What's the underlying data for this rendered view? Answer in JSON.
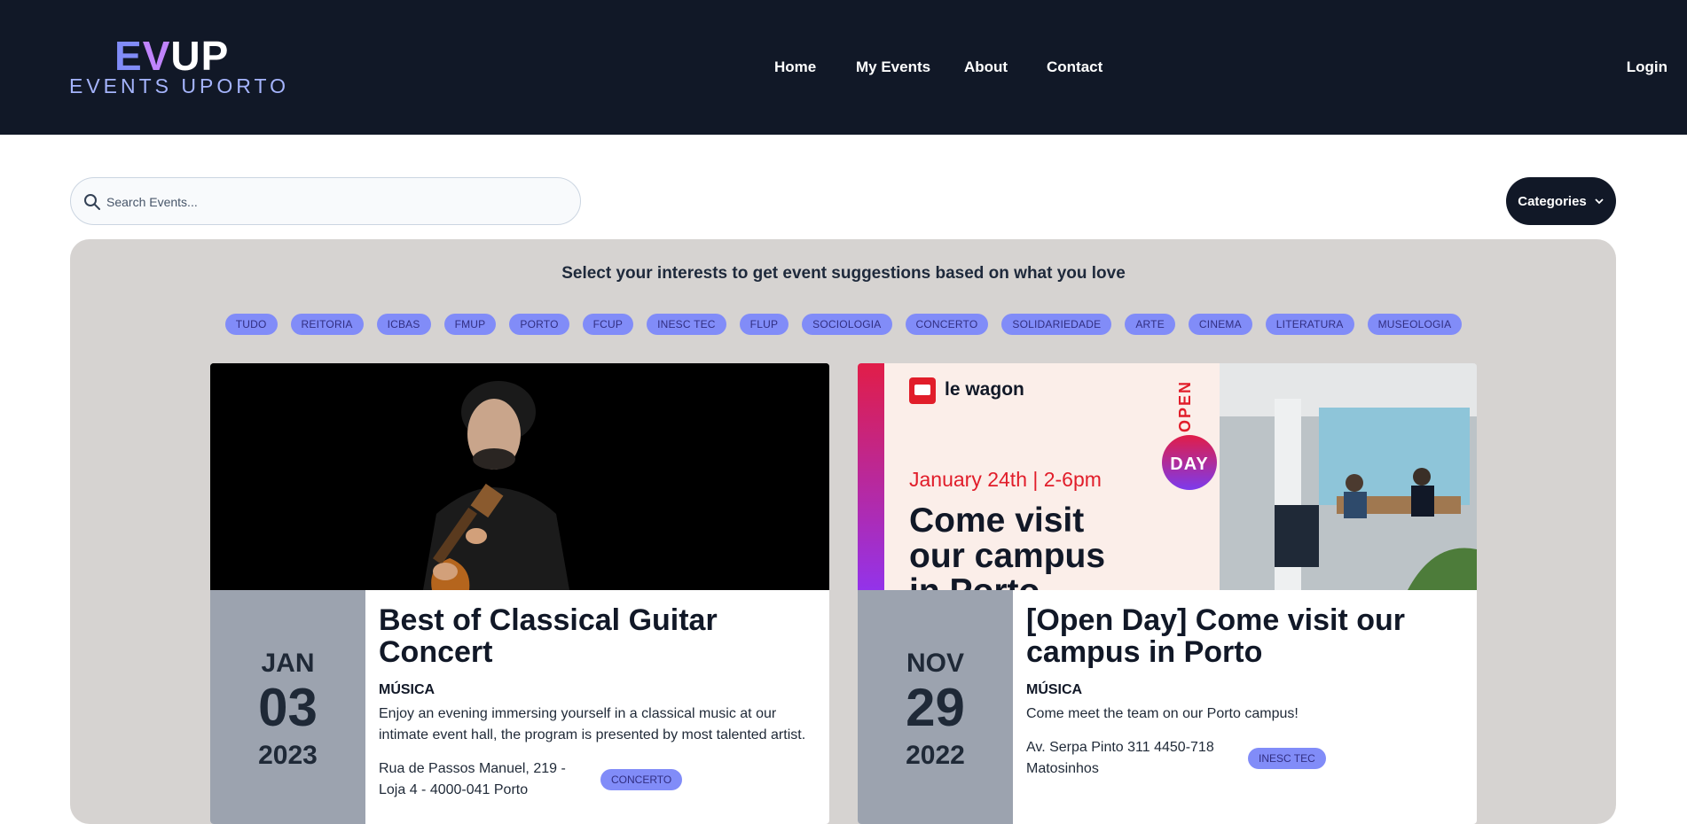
{
  "brand": {
    "logo_e": "E",
    "logo_v": "V",
    "logo_up": "UP",
    "subtitle": "EVENTS UPORTO"
  },
  "nav": {
    "items": [
      "Home",
      "My Events",
      "About",
      "Contact"
    ],
    "login": "Login"
  },
  "search": {
    "placeholder": "Search Events..."
  },
  "categories_button": {
    "label": "Categories"
  },
  "interests": {
    "heading": "Select your interests to get event suggestions based on what you love",
    "chips": [
      "TUDO",
      "REITORIA",
      "ICBAS",
      "FMUP",
      "PORTO",
      "FCUP",
      "INESC TEC",
      "FLUP",
      "SOCIOLOGIA",
      "CONCERTO",
      "SOLIDARIEDADE",
      "ARTE",
      "CINEMA",
      "LITERATURA",
      "MUSEOLOGIA"
    ]
  },
  "events": [
    {
      "month": "JAN",
      "day": "03",
      "year": "2023",
      "title": "Best of Classical Guitar Concert",
      "category": "MÚSICA",
      "description": "Enjoy an evening immersing yourself in a classical music at our intimate event hall, the program is presented by most talented artist.",
      "location": "Rua de Passos Manuel, 219 - Loja 4 - 4000-041 Porto",
      "tag": "CONCERTO"
    },
    {
      "month": "NOV",
      "day": "29",
      "year": "2022",
      "title": "[Open Day] Come visit our campus in Porto",
      "category": "MÚSICA",
      "description": "Come meet the team on our Porto campus!",
      "location": "Av. Serpa Pinto 311 4450-718 Matosinhos",
      "tag": "INESC TEC",
      "banner": {
        "brand": "le wagon",
        "open": "OPEN",
        "day_badge": "DAY",
        "when": "January 24th | 2-6pm",
        "headline": "Come visit our campus in Porto"
      }
    }
  ],
  "colors": {
    "header": "#111827",
    "chip": "#818cf8",
    "panel": "#d6d3d1",
    "date_block": "#9ca3af"
  }
}
